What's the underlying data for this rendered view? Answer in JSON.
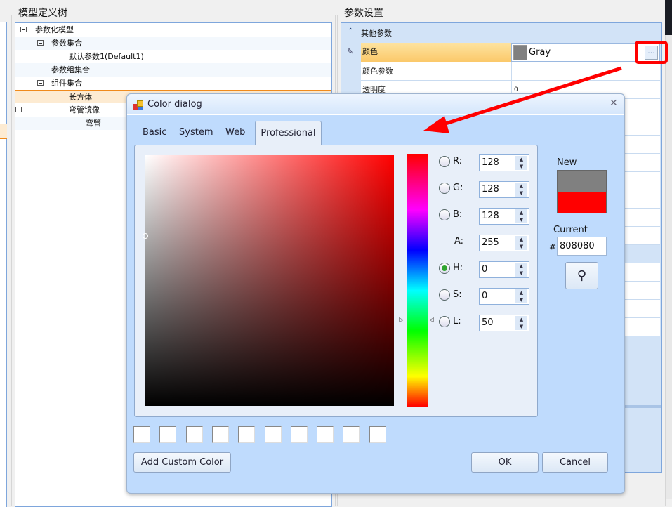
{
  "left_panel": {
    "title": "模型定义树",
    "tree": [
      {
        "label": "参数化模型",
        "level": 0,
        "expander": true
      },
      {
        "label": "参数集合",
        "level": 1,
        "expander": true
      },
      {
        "label": "默认参数1(Default1)",
        "level": 2,
        "expander": false
      },
      {
        "label": "参数组集合",
        "level": 1,
        "expander": false
      },
      {
        "label": "组件集合",
        "level": 1,
        "expander": true
      },
      {
        "label": "长方体",
        "level": 2,
        "expander": false,
        "selected": true
      },
      {
        "label": "弯管镜像",
        "level": 2,
        "expander": true
      },
      {
        "label": "弯管",
        "level": 3,
        "expander": false
      }
    ]
  },
  "right_panel": {
    "title": "参数设置",
    "category": "其他参数",
    "rows": [
      {
        "name": "颜色",
        "value": "Gray",
        "swatch": "#808080",
        "selected": true
      },
      {
        "name": "颜色参数",
        "value": ""
      },
      {
        "name": "透明度",
        "value": "0"
      }
    ],
    "ellipsis_label": "..."
  },
  "dialog": {
    "title": "Color dialog",
    "tabs": [
      "Basic",
      "System",
      "Web",
      "Professional"
    ],
    "active_tab": "Professional",
    "fields": [
      {
        "label": "R:",
        "value": "128",
        "radio": true,
        "checked": false
      },
      {
        "label": "G:",
        "value": "128",
        "radio": true,
        "checked": false
      },
      {
        "label": "B:",
        "value": "128",
        "radio": true,
        "checked": false
      },
      {
        "label": "A:",
        "value": "255",
        "radio": false,
        "checked": false
      },
      {
        "label": "H:",
        "value": "0",
        "radio": true,
        "checked": true
      },
      {
        "label": "S:",
        "value": "0",
        "radio": true,
        "checked": false
      },
      {
        "label": "L:",
        "value": "50",
        "radio": true,
        "checked": false
      }
    ],
    "new_label": "New",
    "current_label": "Current",
    "hash": "#",
    "hex_value": "808080",
    "new_color": "#808080",
    "current_color": "#ff0000",
    "add_custom_label": "Add Custom Color",
    "ok_label": "OK",
    "cancel_label": "Cancel",
    "close_glyph": "✕"
  },
  "colors": {
    "accent": "#ff0000",
    "dialog_bg": "#bfdbfd"
  }
}
